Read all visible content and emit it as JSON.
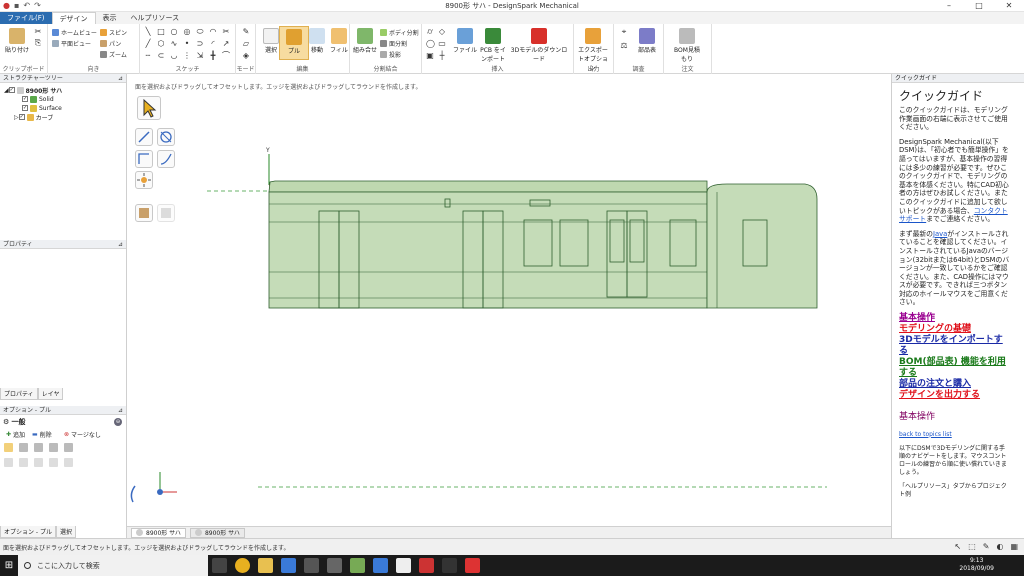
{
  "window": {
    "title": "8900形 サハ - DesignSpark Mechanical",
    "min": "–",
    "max": "□",
    "close": "✕"
  },
  "tabs": [
    "ファイル(F)",
    "デザイン",
    "表示",
    "ヘルプリソース"
  ],
  "ribbon": {
    "clipboard": {
      "paste": "貼り付け",
      "label": "クリップボード"
    },
    "orient": {
      "home": "ホームビュー",
      "plane": "平面ビュー",
      "spin": "スピン",
      "pan": "パン",
      "zoom": "ズーム",
      "label": "向き"
    },
    "sketch": {
      "label": "スケッチ"
    },
    "mode": {
      "label": "モード"
    },
    "edit": {
      "select": "選択",
      "pull": "プル",
      "move": "移動",
      "fill": "フィル",
      "label": "編集"
    },
    "intersect": {
      "combine": "組み合せ",
      "split_body": "ボディ分割",
      "split_face": "面分割",
      "project": "投影",
      "label": "分割結合"
    },
    "insert": {
      "file": "ファイル",
      "pcb": "PCB をインポート",
      "model3d": "3Dモデルのダウンロード",
      "label": "挿入"
    },
    "output": {
      "export": "エクスポートオプション",
      "label": "出力"
    },
    "investigate": {
      "parts": "部品表",
      "label": "調査"
    },
    "order": {
      "bom": "BOM見積もり",
      "label": "注文"
    }
  },
  "structure": {
    "header": "ストラクチャーツリー",
    "root": "8900形 サハ",
    "items": [
      "Solid",
      "Surface",
      "カーブ"
    ]
  },
  "properties": {
    "header": "プロパティ",
    "tabs": [
      "プロパティ",
      "レイヤ"
    ]
  },
  "options": {
    "header": "オプション - プル",
    "group": "一般",
    "add": "追加",
    "remove": "削除",
    "no_merge": "マージなし",
    "tabs": [
      "オプション - プル",
      "選択"
    ]
  },
  "viewport": {
    "hint": "面を選択およびドラッグしてオフセットします。エッジを選択およびドラッグしてラウンドを作成します。",
    "axis_y": "Y",
    "axis_x": "X"
  },
  "doc_tabs": [
    "8900形 サハ",
    "8900形 サハ"
  ],
  "quickguide": {
    "header": "クイックガイド",
    "title": "クイックガイド",
    "p1": "このクイックガイドは、モデリング作業画面の右端に表示させてご使用ください。",
    "p2": "DesignSpark Mechanical(以下DSM)は、「初心者でも簡単操作」を謳ってはいますが、基本操作の習得には多少の練習が必要です。ぜひこのクイックガイドで、モデリングの基本を体感ください。特にCAD初心者の方はぜひお試しください。",
    "p3a": "またこのクイックガイドに追加して欲しいトピックがある場合、",
    "p3link": "コンタクト サポート",
    "p3b": "までご連絡ください。",
    "p4a": "まず最新の",
    "p4link": "Java",
    "p4b": "がインストールされていることを確認してください。インストールされているJavaのバージョン(32bitまたは64bit)とDSMのバージョンが一致しているかをご確認ください。また、CAD操作にはマウスが必要です。できれば三つボタン対応のホイールマウスをご用意ください。",
    "links": [
      {
        "text": "基本操作",
        "color": "#9a0090"
      },
      {
        "text": "モデリングの基礎",
        "color": "#e0101a"
      },
      {
        "text": "3Dモデルをインポートする",
        "color": "#1a2aa6"
      },
      {
        "text": "BOM(部品表) 機能を利用する",
        "color": "#1a7a1a"
      },
      {
        "text": "部品の注文と購入",
        "color": "#1a2aa6"
      },
      {
        "text": "デザインを出力する",
        "color": "#e0101a"
      }
    ],
    "section": "基本操作",
    "back": "back to topics list",
    "p5": "以下にDSMで3Dモデリングに関する手順のナビゲートをします。マウスコントロールの練習から順に使い慣れていきましょう。",
    "p6": "「ヘルプリソース」タブからプロジェクト例"
  },
  "status": {
    "text": "面を選択およびドラッグしてオフセットします。エッジを選択およびドラッグしてラウンドを作成します。"
  },
  "taskbar": {
    "search": "ここに入力して検索",
    "time": "9:13",
    "date": "2018/09/09"
  },
  "colors": {
    "model_fill": "#c5dcb8",
    "model_line": "#2f5f2f",
    "accent": "#2b6cb0"
  }
}
